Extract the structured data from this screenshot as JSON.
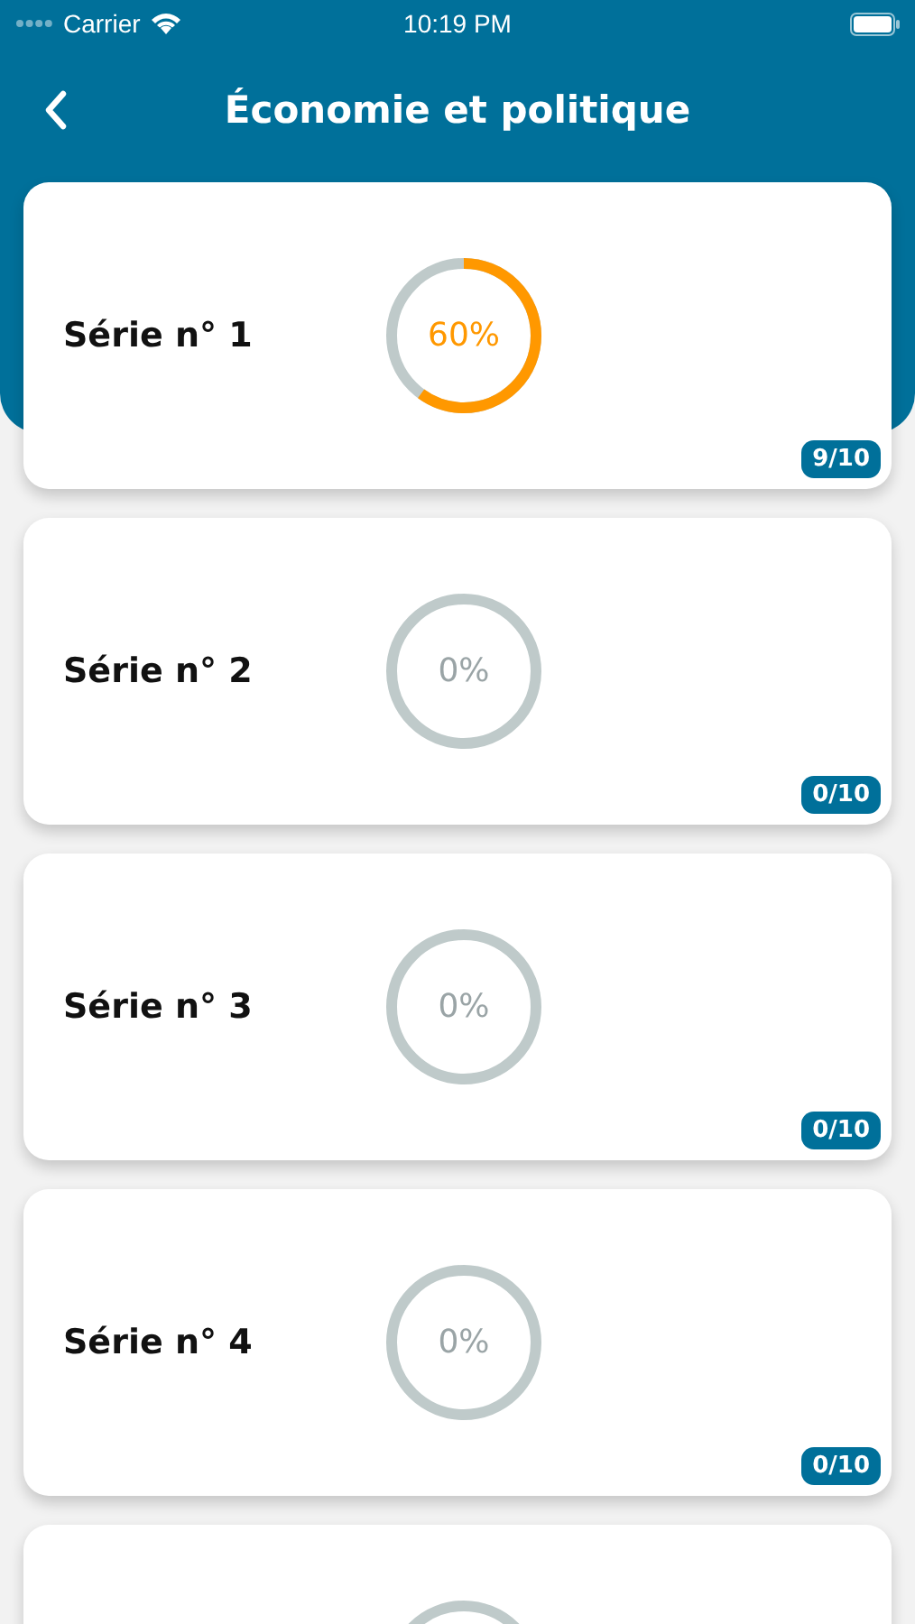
{
  "status_bar": {
    "carrier": "Carrier",
    "time": "10:19 PM"
  },
  "header": {
    "title": "Économie et politique"
  },
  "series": [
    {
      "title": "Série n° 1",
      "percent": "60%",
      "level": 0.6,
      "score": "9/10"
    },
    {
      "title": "Série n° 2",
      "percent": "0%",
      "level": 0,
      "score": "0/10"
    },
    {
      "title": "Série n° 3",
      "percent": "0%",
      "level": 0,
      "score": "0/10"
    },
    {
      "title": "Série n° 4",
      "percent": "0%",
      "level": 0,
      "score": "0/10"
    },
    {
      "level": 0
    }
  ]
}
